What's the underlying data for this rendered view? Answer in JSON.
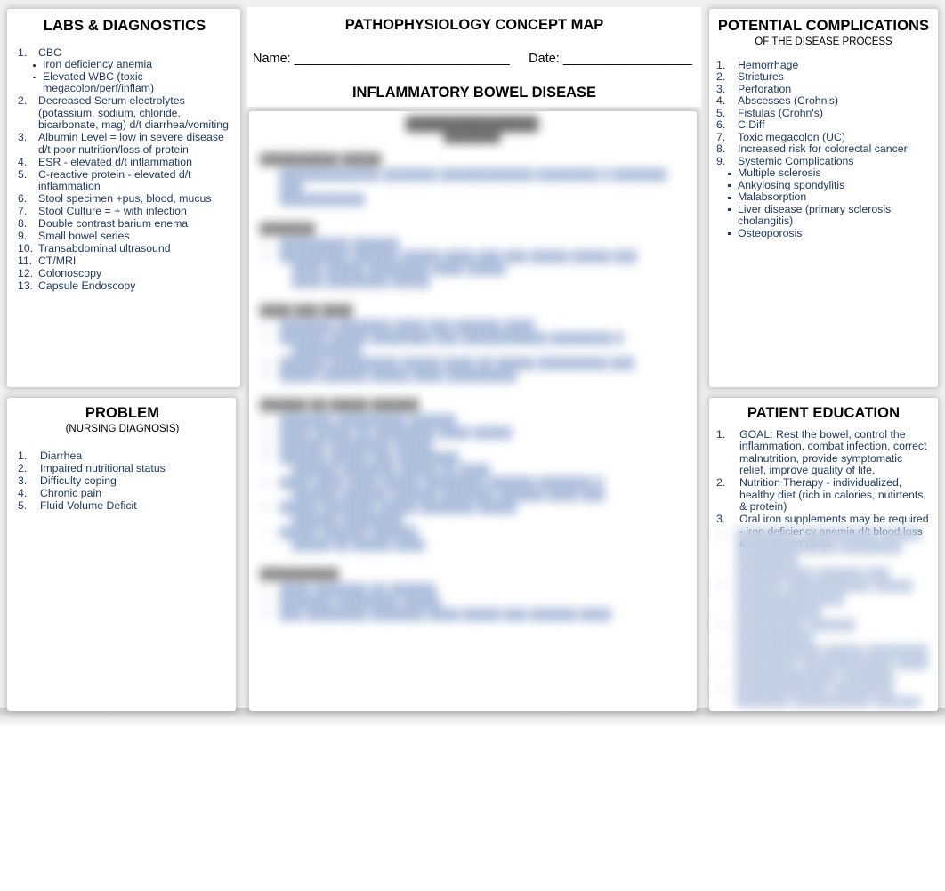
{
  "header": {
    "doc_title": "PATHOPHYSIOLOGY CONCEPT MAP",
    "name_label": "Name: ______________________________",
    "date_label": "Date: __________________",
    "disease_title": "INFLAMMATORY BOWEL DISEASE"
  },
  "labs": {
    "title": "LABS & DIAGNOSTICS",
    "items": [
      {
        "num": "1.",
        "text": "CBC",
        "sub": [
          "Iron deficiency anemia",
          "Elevated WBC (toxic megacolon/perf/inflam)"
        ]
      },
      {
        "num": "2.",
        "text": "Decreased Serum electrolytes (potassium, sodium, chloride, bicarbonate, mag) d/t diarrhea/vomiting",
        "sub": []
      },
      {
        "num": "3.",
        "text": "Albumin Level = low in severe disease d/t poor nutrition/loss of protein",
        "sub": []
      },
      {
        "num": "4.",
        "text": "ESR - elevated d/t inflammation",
        "sub": []
      },
      {
        "num": "5.",
        "text": "C-reactive protein - elevated d/t inflammation",
        "sub": []
      },
      {
        "num": "6.",
        "text": "Stool specimen +pus, blood, mucus",
        "sub": []
      },
      {
        "num": "7.",
        "text": "Stool Culture = + with infection",
        "sub": []
      },
      {
        "num": "8.",
        "text": "Double contrast barium enema",
        "sub": []
      },
      {
        "num": "9.",
        "text": "Small bowel series",
        "sub": []
      },
      {
        "num": "10.",
        "text": "Transabdominal ultrasound",
        "sub": []
      },
      {
        "num": "11.",
        "text": "CT/MRI",
        "sub": []
      },
      {
        "num": "12.",
        "text": "Colonoscopy",
        "sub": []
      },
      {
        "num": "13.",
        "text": "Capsule Endoscopy",
        "sub": []
      }
    ]
  },
  "problem": {
    "title": "PROBLEM",
    "subtitle": "(NURSING DIAGNOSIS)",
    "items": [
      {
        "num": "1.",
        "text": "Diarrhea"
      },
      {
        "num": "2.",
        "text": "Impaired nutritional status"
      },
      {
        "num": "3.",
        "text": "Difficulty coping"
      },
      {
        "num": "4.",
        "text": "Chronic pain"
      },
      {
        "num": "5.",
        "text": "Fluid Volume Deficit"
      }
    ]
  },
  "complications": {
    "title": "POTENTIAL COMPLICATIONS",
    "subtitle": "OF THE DISEASE PROCESS",
    "items": [
      {
        "num": "1.",
        "text": "Hemorrhage"
      },
      {
        "num": "2.",
        "text": "Strictures"
      },
      {
        "num": "3.",
        "text": "Perforation"
      },
      {
        "num": "4.",
        "text": "Abscesses (Crohn's)"
      },
      {
        "num": "5.",
        "text": "Fistulas (Crohn's)"
      },
      {
        "num": "6.",
        "text": "C.Diff"
      },
      {
        "num": "7.",
        "text": "Toxic megacolon (UC)"
      },
      {
        "num": "8.",
        "text": "Increased risk for colorectal cancer"
      },
      {
        "num": "9.",
        "text": "Systemic Complications"
      }
    ],
    "sub_items": [
      "Multiple sclerosis",
      "Ankylosing spondylitis",
      "Malabsorption",
      "Liver disease (primary sclerosis cholangitis)",
      "Osteoporosis"
    ]
  },
  "education": {
    "title": "PATIENT EDUCATION",
    "items": [
      {
        "num": "1.",
        "text": "GOAL: Rest the bowel, control the inflammation, combat infection, correct malnutrition, provide symptomatic relief, improve quality of life."
      },
      {
        "num": "2.",
        "text": "Nutrition Therapy - individualized, healthy diet (rich in calories, nutirtents, & protein)"
      },
      {
        "num": "3.",
        "text": "Oral iron supplements may be required - iron deficiency anemia d/t blood loss and malabsorption."
      }
    ],
    "redacted_lines": [
      {
        "num": "4.",
        "text": "████████ ██████████ █████"
      },
      {
        "num": "",
        "text": "█████████████ ████████ ████████"
      },
      {
        "num": "",
        "text": "██████████ ██████ ███"
      },
      {
        "num": "5.",
        "text": "██████ ███████████ █████"
      },
      {
        "num": "",
        "text": "██████████████ ███████████"
      },
      {
        "num": "6.",
        "text": "█████████ ██████ ██████████"
      },
      {
        "num": "",
        "text": "███████████ █████ ████████"
      },
      {
        "num": "7.",
        "text": "████████ ████████████ ████"
      },
      {
        "num": "",
        "text": "█████████████ ███████"
      },
      {
        "num": "8.",
        "text": "████████████ ████████"
      },
      {
        "num": "",
        "text": "███████ ██████████ ██████"
      },
      {
        "num": "9.",
        "text": "██████ ████████ ███████████"
      }
    ]
  },
  "concept_map": {
    "status": "blurred-redacted",
    "heading": "██████████████",
    "subheading": "█████████",
    "sections": [
      {
        "heading": "██████████ █████",
        "lines": [
          {
            "num": "",
            "text": "█████████████ ███████ ████████████ ████████ █ ███████ ███",
            "indent": false
          },
          {
            "num": "",
            "text": "███████████",
            "indent": false
          }
        ]
      },
      {
        "heading": "███████",
        "lines": [
          {
            "num": "1.",
            "text": "█████████ ██████",
            "indent": false
          },
          {
            "num": "2.",
            "text": "█████████ ██████ █████ ████ ███ ███ █████ █████ ███",
            "indent": false
          },
          {
            "num": "",
            "text": "████ █████ ████████ ████ █████",
            "indent": true
          },
          {
            "num": "",
            "text": "████ ████████ █████",
            "indent": true
          }
        ]
      },
      {
        "heading": "████ ███ ████",
        "lines": [
          {
            "num": "1.",
            "text": "███████ ███████ ████ ███ ██████ ████",
            "indent": false
          },
          {
            "num": "2.",
            "text": "██████ █████ ████████ ███ ███████████ ████████ █",
            "indent": false
          },
          {
            "num": "",
            "text": "█████████",
            "indent": true
          },
          {
            "num": "3.",
            "text": "██████ █████████ █████ ████ ██ █████ █████████ ███",
            "indent": false
          },
          {
            "num": "4.",
            "text": "█████ ██████ █████ ████ █████████",
            "indent": false
          }
        ]
      },
      {
        "heading": "██████ ██ █████ ██████",
        "lines": [
          {
            "num": "1.",
            "text": "███████ █████████ ██████",
            "indent": false
          },
          {
            "num": "2.",
            "text": "████ █████ ██ ████████ ████ █████",
            "indent": false
          },
          {
            "num": "3.",
            "text": "██████ ████████ █████",
            "indent": false
          },
          {
            "num": "4.",
            "text": "██████ █████ ███ ████████",
            "indent": false
          },
          {
            "num": "",
            "text": "██████ ███████ █████ ██ ████",
            "indent": true
          },
          {
            "num": "5.",
            "text": "████ ████ ████ █████ ████████ ██████ ███████ █",
            "indent": false
          },
          {
            "num": "",
            "text": "██████ ██████ ██████ ███████ ██████ ████ ███",
            "indent": true
          },
          {
            "num": "6.",
            "text": "█████ ███████ █████ ███████ █████",
            "indent": false
          },
          {
            "num": "",
            "text": "██████ ████████",
            "indent": true
          },
          {
            "num": "7.",
            "text": "█████ ██████ ██████",
            "indent": false
          },
          {
            "num": "",
            "text": "█████ ██ █████ ████",
            "indent": true
          }
        ]
      },
      {
        "heading": "██████████",
        "lines": [
          {
            "num": "1.",
            "text": "████ ███████ ██ ██████",
            "indent": false
          },
          {
            "num": "2.",
            "text": "███████ ████████ █████",
            "indent": false
          },
          {
            "num": "3.",
            "text": "███ ████████ ███████ ████ █████ ███ ██████ ████",
            "indent": false
          }
        ]
      }
    ]
  }
}
